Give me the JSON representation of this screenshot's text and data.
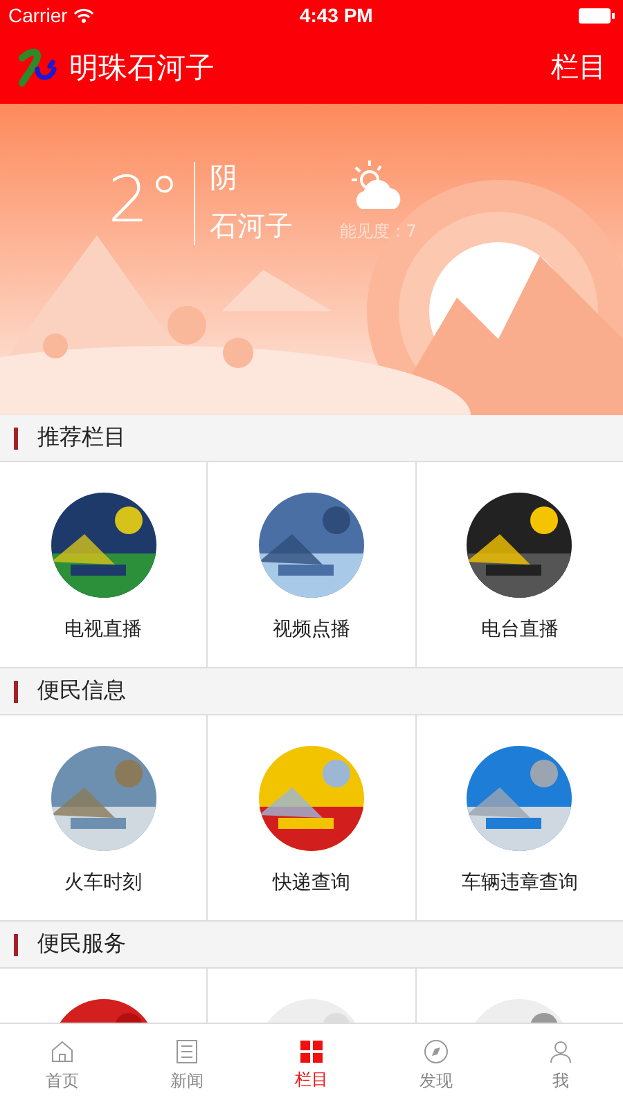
{
  "status_bar": {
    "carrier": "Carrier",
    "time": "4:43 PM"
  },
  "header": {
    "title": "明珠石河子",
    "action": "栏目"
  },
  "weather": {
    "temperature": "2°",
    "condition": "阴",
    "city": "石河子",
    "visibility": "能见度：7"
  },
  "sections": [
    {
      "title": "推荐栏目",
      "items": [
        {
          "label": "电视直播"
        },
        {
          "label": "视频点播"
        },
        {
          "label": "电台直播"
        }
      ]
    },
    {
      "title": "便民信息",
      "items": [
        {
          "label": "火车时刻"
        },
        {
          "label": "快递查询"
        },
        {
          "label": "车辆违章查询"
        }
      ]
    },
    {
      "title": "便民服务"
    }
  ],
  "tabs": [
    {
      "label": "首页",
      "selected": false
    },
    {
      "label": "新闻",
      "selected": false
    },
    {
      "label": "栏目",
      "selected": true
    },
    {
      "label": "发现",
      "selected": false
    },
    {
      "label": "我",
      "selected": false
    }
  ]
}
